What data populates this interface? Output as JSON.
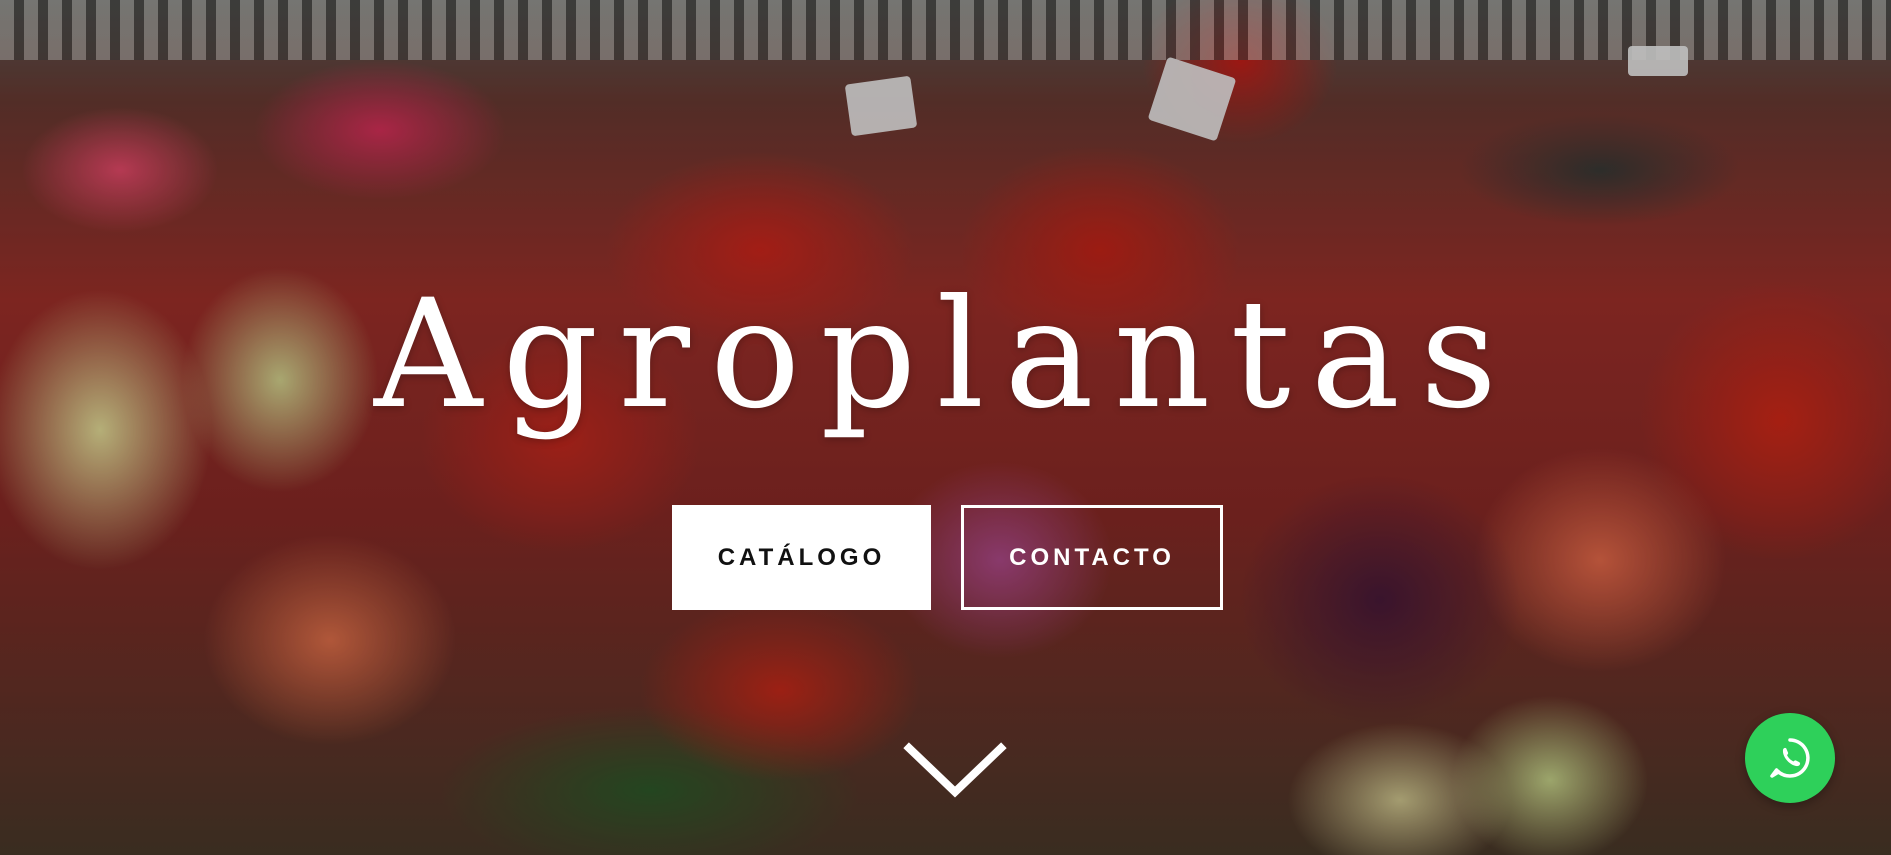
{
  "hero": {
    "title": "Agroplantas",
    "buttons": {
      "catalog_label": "CATÁLOGO",
      "contact_label": "CONTACTO"
    },
    "scroll_icon": "chevron-down-icon"
  },
  "floating": {
    "whatsapp_icon": "whatsapp-icon",
    "whatsapp_color": "#2ED05A"
  },
  "colors": {
    "button_primary_bg": "#FFFFFF",
    "button_primary_text": "#111111",
    "title_color": "#FFFFFF"
  }
}
